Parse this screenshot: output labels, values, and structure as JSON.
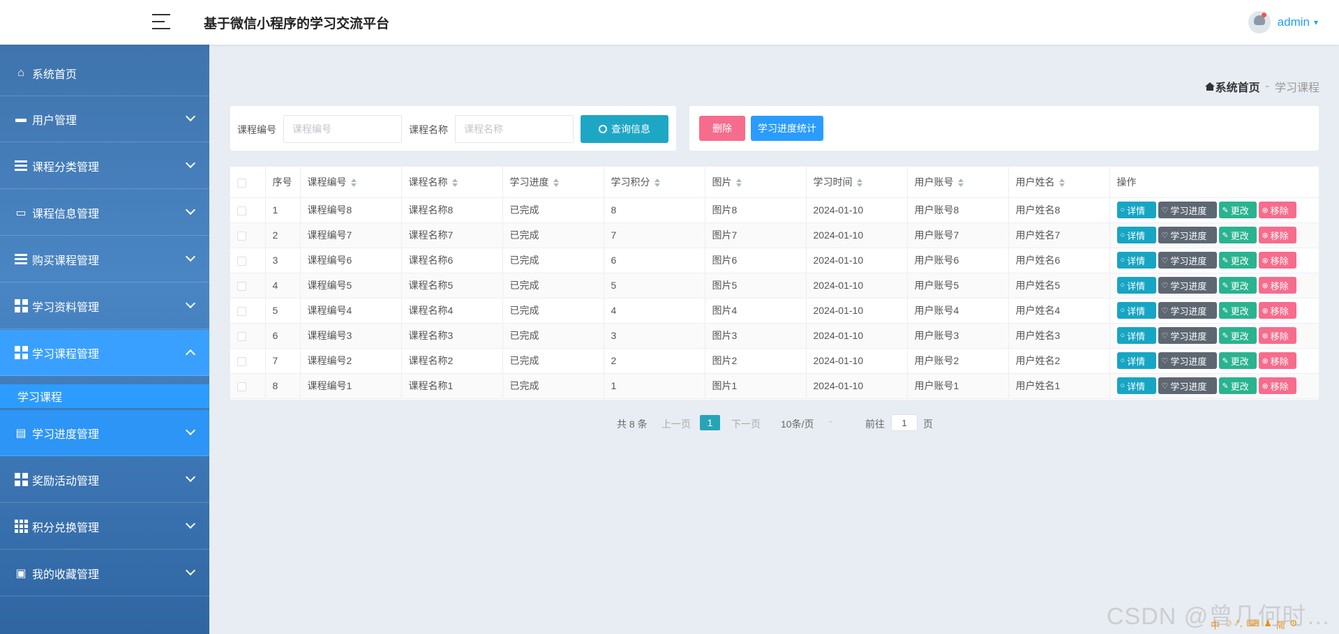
{
  "header": {
    "title": "基于微信小程序的学习交流平台",
    "username": "admin",
    "caret": "▾"
  },
  "sidebar": {
    "items": [
      {
        "label": "系统首页",
        "icon": "home-icon"
      },
      {
        "label": "用户管理",
        "icon": "briefcase-icon"
      },
      {
        "label": "课程分类管理",
        "icon": "list-icon"
      },
      {
        "label": "课程信息管理",
        "icon": "monitor-icon"
      },
      {
        "label": "购买课程管理",
        "icon": "lines-icon"
      },
      {
        "label": "学习资料管理",
        "icon": "grid-icon"
      },
      {
        "label": "学习课程管理",
        "icon": "grid-icon"
      },
      {
        "label": "学习进度管理",
        "icon": "chat-icon"
      },
      {
        "label": "奖励活动管理",
        "icon": "grid-icon"
      },
      {
        "label": "积分兑换管理",
        "icon": "grid9-icon"
      },
      {
        "label": "我的收藏管理",
        "icon": "clipboard-icon"
      }
    ],
    "sub_item": "学习课程"
  },
  "breadcrumb": {
    "home": "系统首页",
    "sep": "-",
    "current": "学习课程"
  },
  "search": {
    "field1_label": "课程编号",
    "field1_placeholder": "课程编号",
    "field2_label": "课程名称",
    "field2_placeholder": "课程名称",
    "button": "查询信息"
  },
  "actions": {
    "delete": "删除",
    "stats": "学习进度统计"
  },
  "table": {
    "headers": [
      "序号",
      "课程编号",
      "课程名称",
      "学习进度",
      "学习积分",
      "图片",
      "学习时间",
      "用户账号",
      "用户姓名",
      "操作"
    ],
    "op_labels": {
      "detail": "详情",
      "progress": "学习进度",
      "edit": "更改",
      "remove": "移除"
    },
    "rows": [
      {
        "idx": "1",
        "code": "课程编号8",
        "name": "课程名称8",
        "progress": "已完成",
        "points": "8",
        "image": "图片8",
        "time": "2024-01-10",
        "account": "用户账号8",
        "uname": "用户姓名8"
      },
      {
        "idx": "2",
        "code": "课程编号7",
        "name": "课程名称7",
        "progress": "已完成",
        "points": "7",
        "image": "图片7",
        "time": "2024-01-10",
        "account": "用户账号7",
        "uname": "用户姓名7"
      },
      {
        "idx": "3",
        "code": "课程编号6",
        "name": "课程名称6",
        "progress": "已完成",
        "points": "6",
        "image": "图片6",
        "time": "2024-01-10",
        "account": "用户账号6",
        "uname": "用户姓名6"
      },
      {
        "idx": "4",
        "code": "课程编号5",
        "name": "课程名称5",
        "progress": "已完成",
        "points": "5",
        "image": "图片5",
        "time": "2024-01-10",
        "account": "用户账号5",
        "uname": "用户姓名5"
      },
      {
        "idx": "5",
        "code": "课程编号4",
        "name": "课程名称4",
        "progress": "已完成",
        "points": "4",
        "image": "图片4",
        "time": "2024-01-10",
        "account": "用户账号4",
        "uname": "用户姓名4"
      },
      {
        "idx": "6",
        "code": "课程编号3",
        "name": "课程名称3",
        "progress": "已完成",
        "points": "3",
        "image": "图片3",
        "time": "2024-01-10",
        "account": "用户账号3",
        "uname": "用户姓名3"
      },
      {
        "idx": "7",
        "code": "课程编号2",
        "name": "课程名称2",
        "progress": "已完成",
        "points": "2",
        "image": "图片2",
        "time": "2024-01-10",
        "account": "用户账号2",
        "uname": "用户姓名2"
      },
      {
        "idx": "8",
        "code": "课程编号1",
        "name": "课程名称1",
        "progress": "已完成",
        "points": "1",
        "image": "图片1",
        "time": "2024-01-10",
        "account": "用户账号1",
        "uname": "用户姓名1"
      }
    ]
  },
  "pager": {
    "total": "共 8 条",
    "prev": "上一页",
    "current": "1",
    "next": "下一页",
    "size": "10条/页",
    "goto": "前往",
    "goto_value": "1",
    "page_unit": "页"
  },
  "watermark": "CSDN @曾几何时…",
  "ime": [
    "中",
    "☽",
    "°,",
    "⌨",
    "♟",
    "简",
    "⚙"
  ],
  "colors": {
    "accent": "#1e9fff",
    "search_button": "#1ea7c5",
    "delete_button": "#f76c8c",
    "stats_button": "#2a9cff",
    "detail_button": "#17a5c4",
    "progress_button": "#5d6772",
    "edit_button": "#2ab38f",
    "remove_button": "#f76c8c",
    "sidebar_active": "#3aa0ff"
  }
}
